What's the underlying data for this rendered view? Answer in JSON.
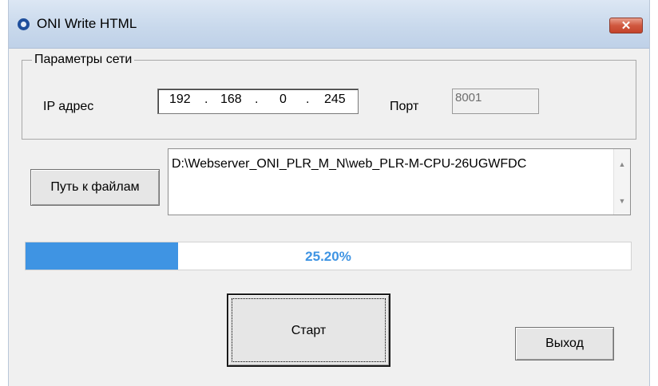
{
  "window": {
    "title": "ONI Write HTML",
    "close_label": "✕",
    "icon": "app-o-icon"
  },
  "network": {
    "group_label": "Параметры сети",
    "ip_label": "IP адрес",
    "ip_octets": [
      "192",
      "168",
      "0",
      "245"
    ],
    "port_label": "Порт",
    "port_value": "8001"
  },
  "files": {
    "button_label": "Путь к файлам",
    "path_value": "D:\\Webserver_ONI_PLR_M_N\\web_PLR-M-CPU-26UGWFDC"
  },
  "progress": {
    "percent": 25.2,
    "label": "25.20%",
    "color": "#3f94e3"
  },
  "actions": {
    "start_label": "Старт",
    "exit_label": "Выход"
  }
}
